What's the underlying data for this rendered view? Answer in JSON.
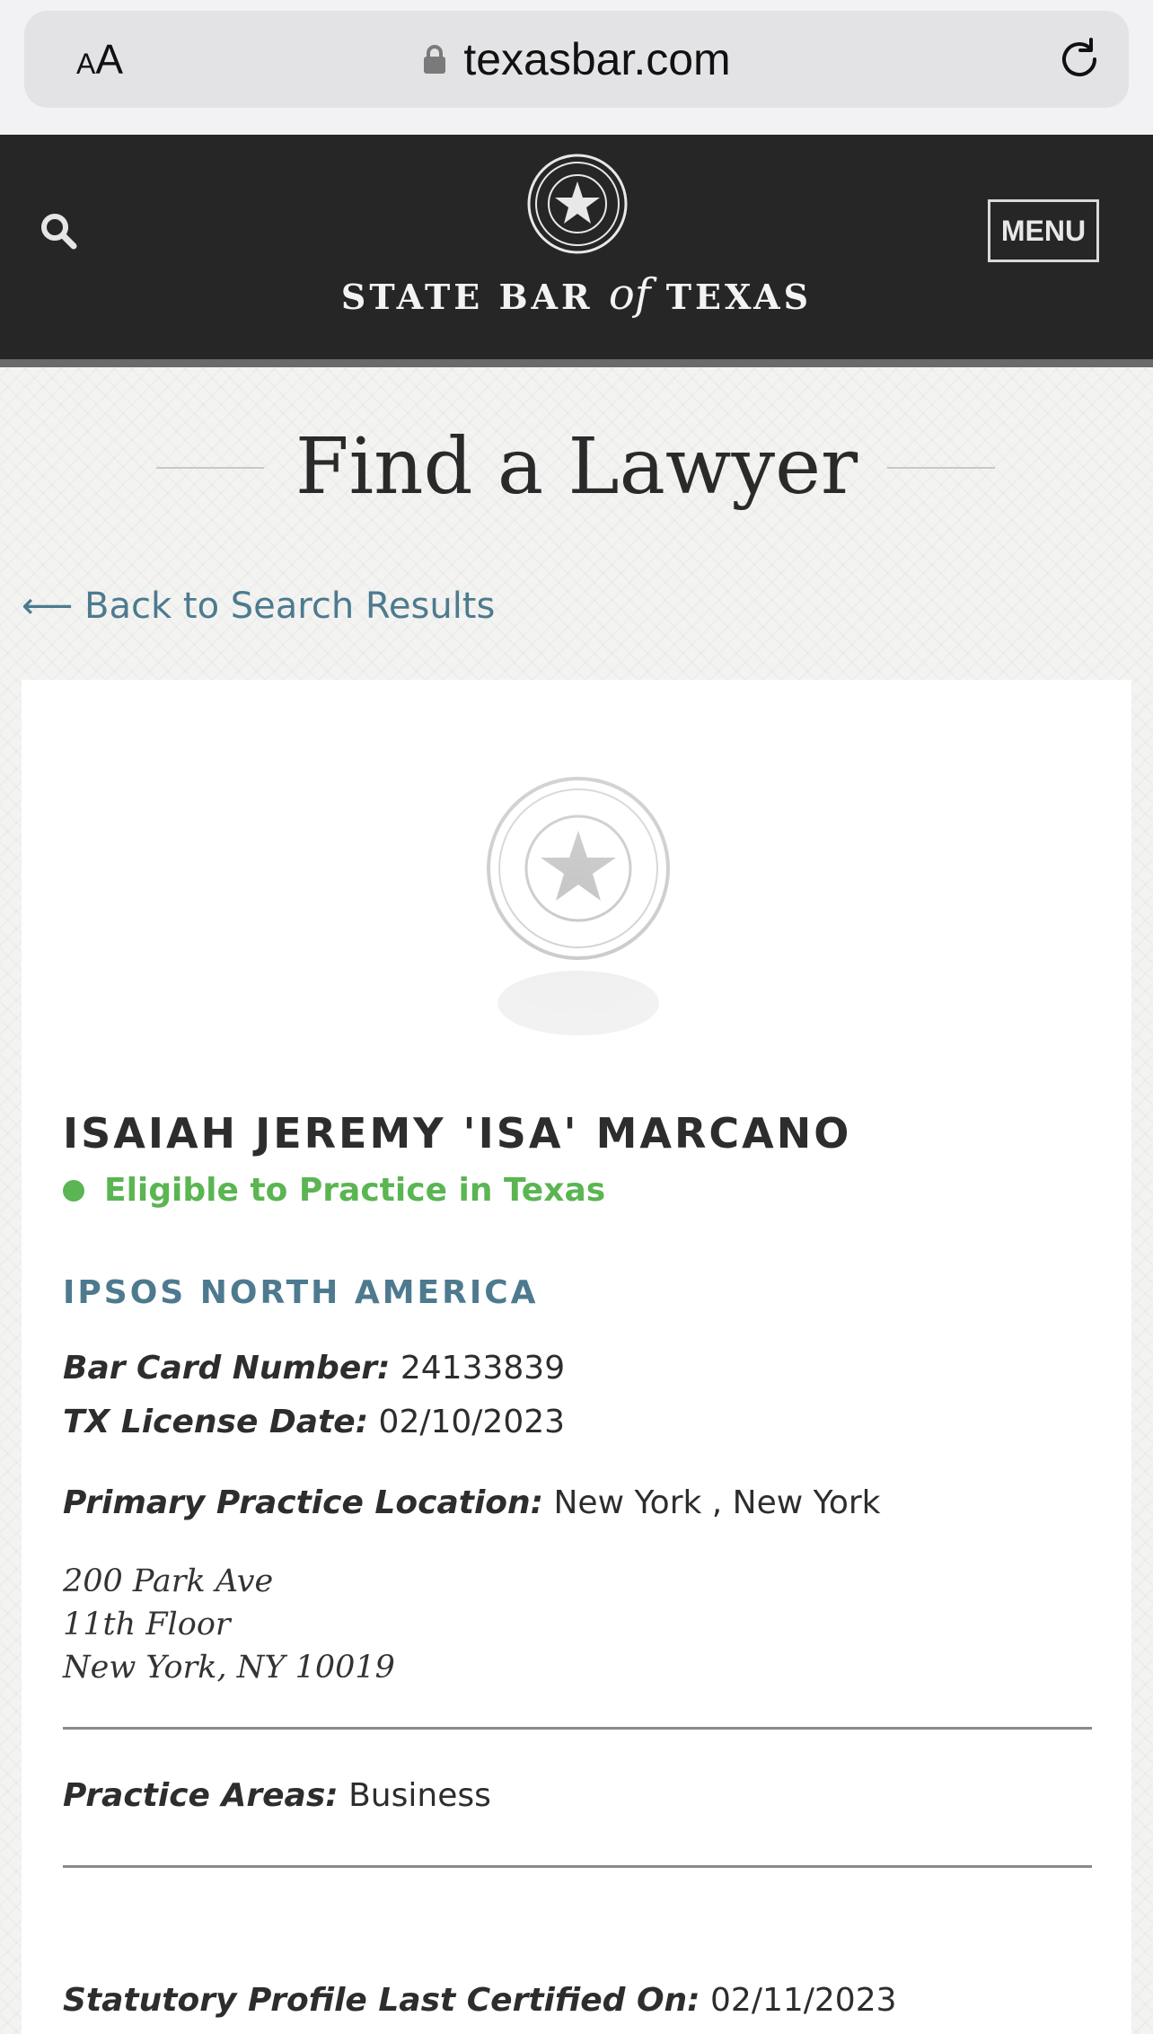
{
  "browser": {
    "text_size_small": "A",
    "text_size_big": "A",
    "url": "texasbar.com"
  },
  "header": {
    "logo_word_1": "State Bar",
    "logo_word_of": "of",
    "logo_word_2": "Texas",
    "menu_label": "MENU"
  },
  "page": {
    "title": "Find a Lawyer",
    "back_link": "⟵ Back to Search Results"
  },
  "profile": {
    "name": "ISAIAH JEREMY 'ISA' MARCANO",
    "status": "Eligible to Practice in Texas",
    "firm": "IPSOS NORTH AMERICA",
    "bar_card_label": "Bar Card Number:",
    "bar_card_value": "24133839",
    "license_date_label": "TX License Date:",
    "license_date_value": "02/10/2023",
    "location_label": "Primary Practice Location:",
    "location_value": "New York , New York",
    "address_line_1": "200 Park Ave",
    "address_line_2": "11th Floor",
    "address_line_3": "New York, NY 10019",
    "practice_areas_label": "Practice Areas:",
    "practice_areas_value": "Business",
    "certified_label": "Statutory Profile Last Certified On:",
    "certified_value": "02/11/2023"
  },
  "colors": {
    "header_bg": "#262626",
    "link_blue": "#4d7a8f",
    "status_green": "#5ab552"
  },
  "icons": [
    "lock-icon",
    "reload-icon",
    "search-icon",
    "state-bar-seal-icon",
    "profile-seal-placeholder"
  ]
}
